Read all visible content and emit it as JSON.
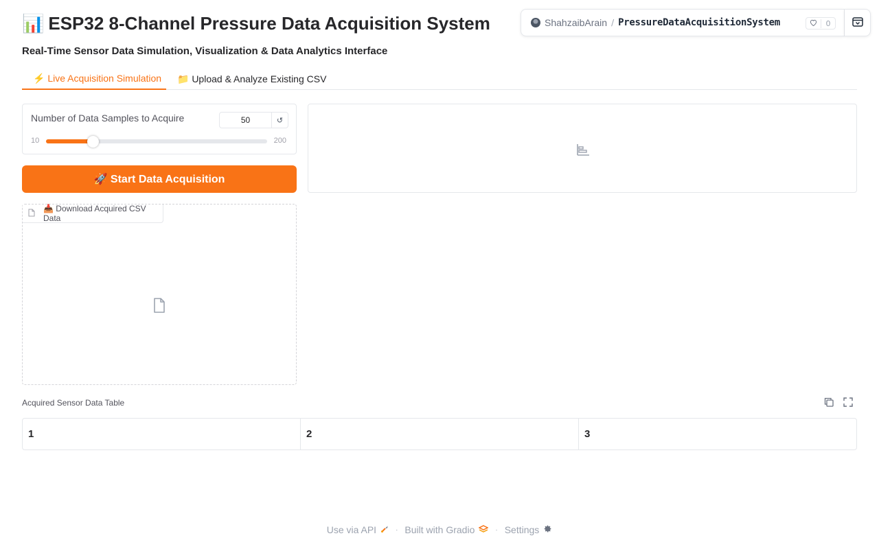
{
  "header": {
    "title_emoji": "📊",
    "title": "ESP32 8-Channel Pressure Data Acquisition System",
    "subtitle": "Real-Time Sensor Data Simulation, Visualization & Data Analytics Interface"
  },
  "space_badge": {
    "user": "ShahzaibArain",
    "separator": "/",
    "repo": "PressureDataAcquisitionSystem",
    "likes": "0",
    "icon_heart": "heart-icon",
    "icon_expand": "expand-icon"
  },
  "tabs": [
    {
      "label": "⚡ Live Acquisition Simulation",
      "active": true
    },
    {
      "label": "📁 Upload & Analyze Existing CSV",
      "active": false
    }
  ],
  "slider": {
    "label": "Number of Data Samples to Acquire",
    "value": "50",
    "min": "10",
    "max": "200",
    "reset_symbol": "↺",
    "fraction": 0.2105
  },
  "start_button": {
    "label": "🚀 Start Data Acquisition"
  },
  "file_download": {
    "label": "📥 Download Acquired CSV Data",
    "icon": "file-icon"
  },
  "plot": {
    "icon": "bar-chart-icon"
  },
  "table": {
    "label": "Acquired Sensor Data Table",
    "headers": [
      "1",
      "2",
      "3"
    ]
  },
  "footer": {
    "api_label": "Use via API",
    "built_label": "Built with Gradio",
    "settings_label": "Settings",
    "separator": "·"
  },
  "colors": {
    "accent": "#f97316",
    "border": "#e5e7eb"
  }
}
